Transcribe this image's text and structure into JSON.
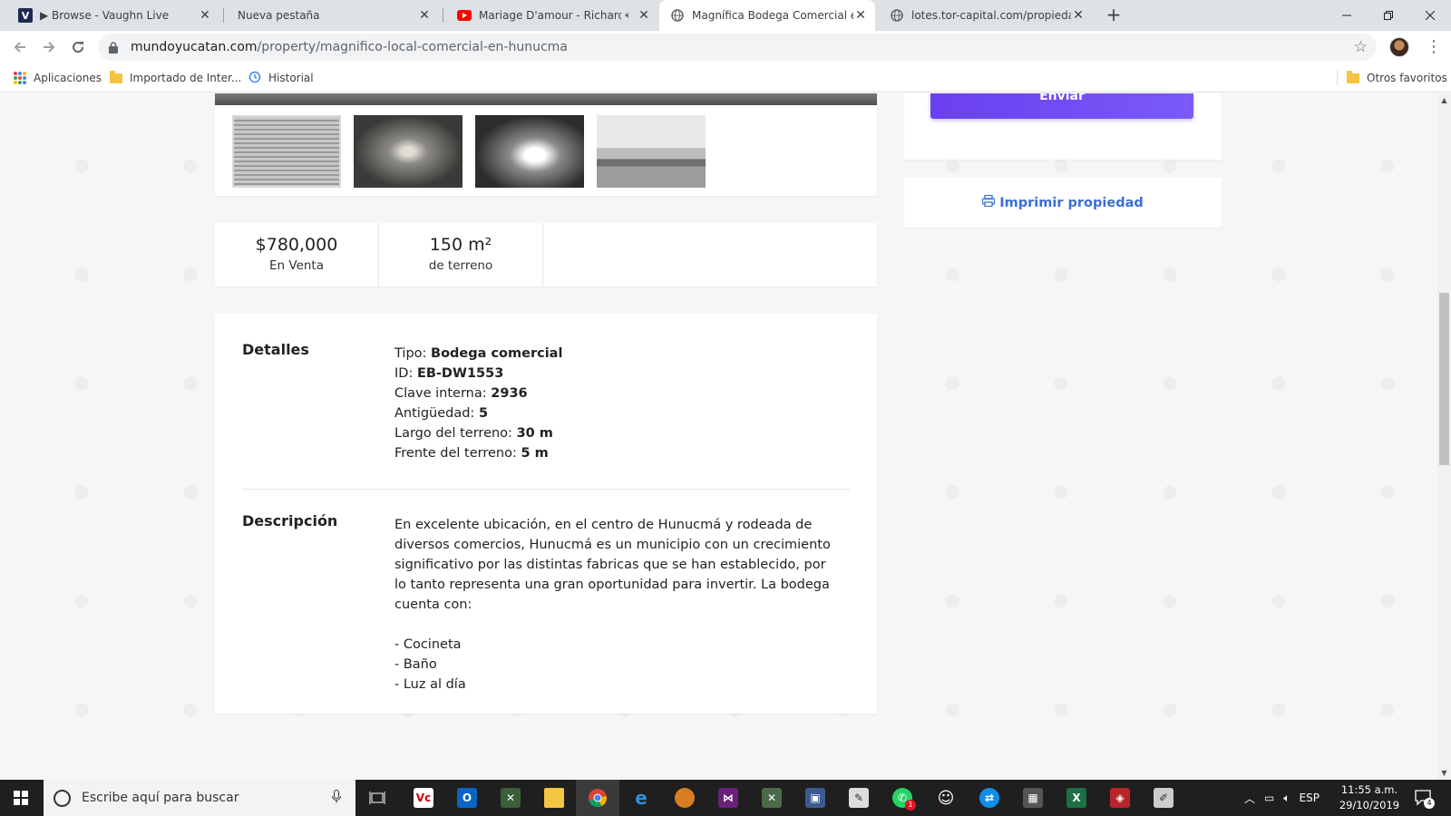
{
  "browser": {
    "tabs": [
      {
        "title": "▶ Browse - Vaughn Live",
        "favicon": "vaughn-v-icon"
      },
      {
        "title": "Nueva pestaña",
        "favicon": ""
      },
      {
        "title": "Mariage D'amour - Richard C",
        "favicon": "youtube-icon",
        "audio": true
      },
      {
        "title": "Magnífica Bodega Comercial en",
        "favicon": "globe-icon",
        "active": true
      },
      {
        "title": "lotes.tor-capital.com/propiedad/",
        "favicon": "globe-icon"
      }
    ],
    "url_host": "mundoyucatan.com",
    "url_path": "/property/magnifico-local-comercial-en-hunucma",
    "bookmarks": [
      "Aplicaciones",
      "Importado de Inter...",
      "Historial"
    ],
    "other_bookmarks": "Otros favoritos"
  },
  "page": {
    "form": {
      "submit_label": "Enviar"
    },
    "print_label": "Imprimir propiedad",
    "price": {
      "value": "$780,000",
      "label": "En Venta"
    },
    "area": {
      "value": "150 m²",
      "label": "de terreno"
    },
    "details": {
      "title": "Detalles",
      "items": [
        {
          "label": "Tipo: ",
          "value": "Bodega comercial"
        },
        {
          "label": "ID: ",
          "value": "EB-DW1553"
        },
        {
          "label": "Clave interna: ",
          "value": "2936"
        },
        {
          "label": "Antigüedad: ",
          "value": "5"
        },
        {
          "label": "Largo del terreno: ",
          "value": "30 m"
        },
        {
          "label": "Frente del terreno: ",
          "value": "5 m"
        }
      ]
    },
    "description": {
      "title": "Descripción",
      "paragraph": "En excelente ubicación, en el centro de Hunucmá y rodeada de diversos comercios, Hunucmá es un municipio con un crecimiento significativo por las distintas fabricas que se han establecido, por lo tanto representa una gran oportunidad para invertir. La bodega cuenta con:",
      "list": [
        "- Cocineta",
        "- Baño",
        "- Luz al día"
      ]
    }
  },
  "taskbar": {
    "search_placeholder": "Escribe aquí para buscar",
    "language": "ESP",
    "time": "11:55 a.m.",
    "date": "29/10/2019",
    "whatsapp_badge": "1",
    "notification_count": "4"
  },
  "colors": {
    "accent_purple": "#6a3ff0",
    "link_blue": "#3b6fd4"
  }
}
